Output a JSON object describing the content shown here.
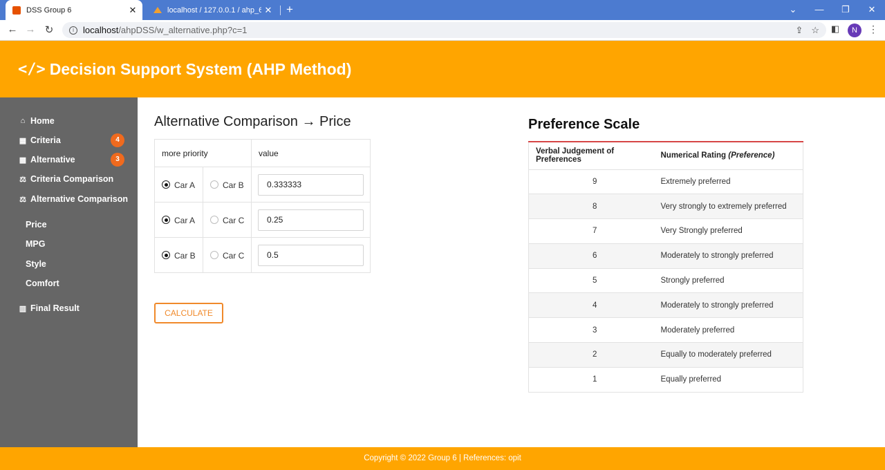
{
  "browser": {
    "tabs": [
      {
        "title": "DSS Group 6",
        "active": true
      },
      {
        "title": "localhost / 127.0.0.1 / ahp_6 | php",
        "active": false
      }
    ],
    "url_host": "localhost",
    "url_path": "/ahpDSS/w_alternative.php?c=1",
    "profile_initial": "N"
  },
  "header": {
    "brand_icon": "</>",
    "title": "Decision Support System (AHP Method)"
  },
  "sidebar": {
    "items": [
      {
        "label": "Home",
        "icon": "home-icon"
      },
      {
        "label": "Criteria",
        "icon": "table-icon",
        "badge": "4"
      },
      {
        "label": "Alternative",
        "icon": "table-icon",
        "badge": "3"
      },
      {
        "label": "Criteria Comparison",
        "icon": "balance-scale-icon"
      },
      {
        "label": "Alternative Comparison",
        "icon": "balance-scale-icon"
      },
      {
        "label": "Final Result",
        "icon": "bar-chart-icon"
      }
    ],
    "sub_items": [
      "Price",
      "MPG",
      "Style",
      "Comfort"
    ]
  },
  "main": {
    "title": "Alternative Comparison",
    "title_arrow": "→",
    "title_criteria": "Price",
    "table": {
      "headers": [
        "more priority",
        "value"
      ],
      "rows": [
        {
          "option_a": "Car A",
          "option_b": "Car B",
          "selected": "a",
          "value": "0.333333"
        },
        {
          "option_a": "Car A",
          "option_b": "Car C",
          "selected": "a",
          "value": "0.25"
        },
        {
          "option_a": "Car B",
          "option_b": "Car C",
          "selected": "a",
          "value": "0.5"
        }
      ]
    },
    "calculate_label": "CALCULATE"
  },
  "preference": {
    "title": "Preference Scale",
    "headers": {
      "col1": "Verbal Judgement of Preferences",
      "col2": "Numerical Rating",
      "col2_em": "(Preference)"
    },
    "rows": [
      {
        "num": "9",
        "text": "Extremely preferred"
      },
      {
        "num": "8",
        "text": "Very strongly to extremely preferred"
      },
      {
        "num": "7",
        "text": "Very Strongly preferred"
      },
      {
        "num": "6",
        "text": "Moderately to strongly preferred"
      },
      {
        "num": "5",
        "text": "Strongly preferred"
      },
      {
        "num": "4",
        "text": "Moderately to strongly preferred"
      },
      {
        "num": "3",
        "text": "Moderately preferred"
      },
      {
        "num": "2",
        "text": "Equally to moderately preferred"
      },
      {
        "num": "1",
        "text": "Equally preferred"
      }
    ]
  },
  "footer": {
    "text": "Copyright © 2022 Group 6 | References: opit"
  },
  "colors": {
    "accent": "#ffa500",
    "sidebar": "#666666",
    "badge": "#f06a1e",
    "button": "#f0892a",
    "table_top_border": "#d64545"
  }
}
